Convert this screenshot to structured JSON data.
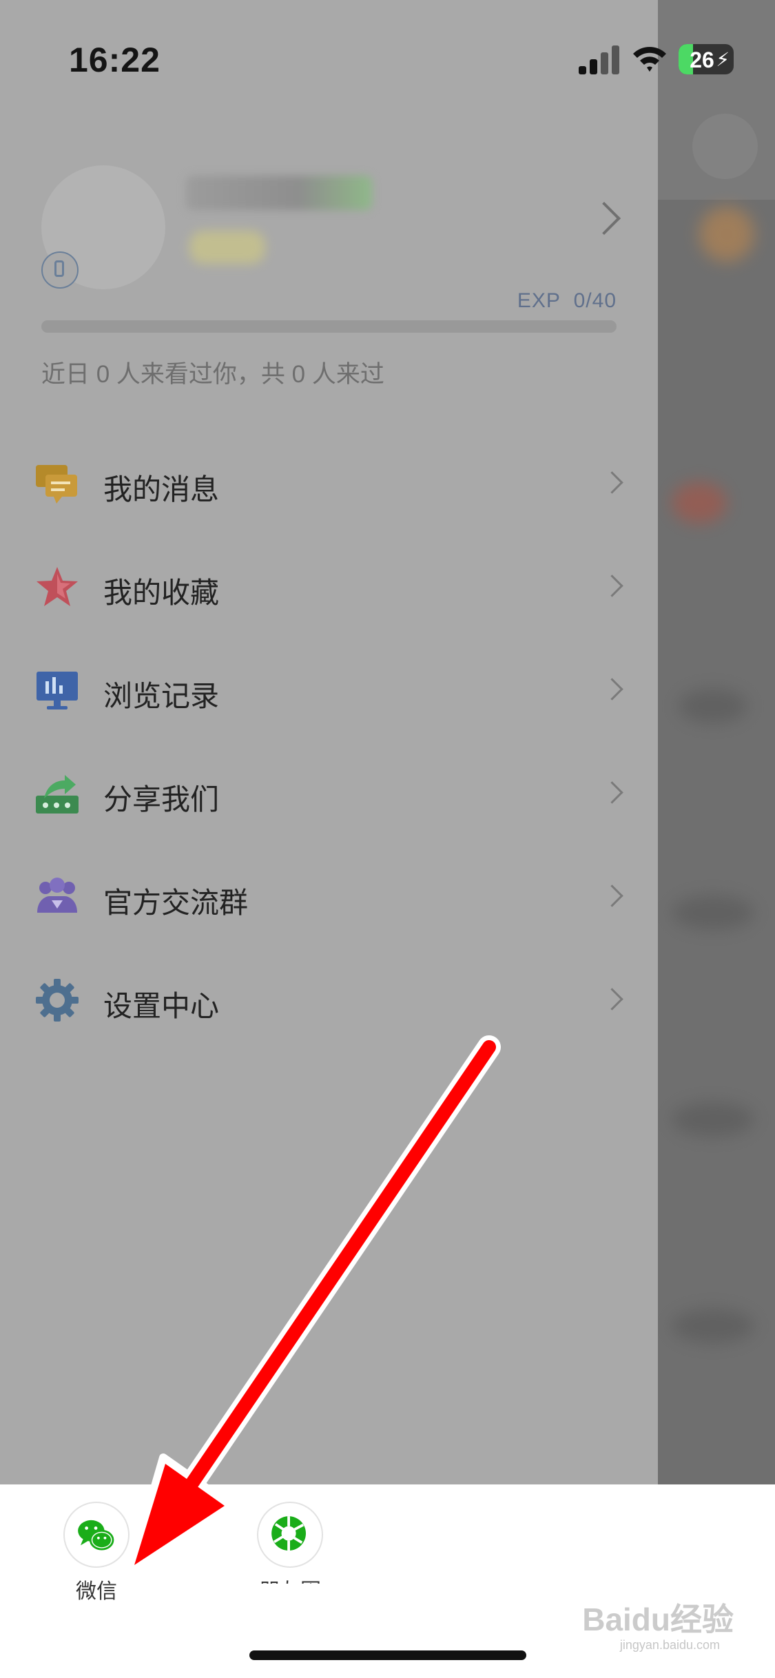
{
  "status_bar": {
    "time": "16:22",
    "battery": "26"
  },
  "profile": {
    "exp_label": "EXP",
    "exp_value": "0/40",
    "exp_progress": 0,
    "visits_text": "近日 0 人来看过你，共 0 人来过"
  },
  "menu": [
    {
      "label": "我的消息",
      "icon": "message-icon",
      "color": "#b58a2a"
    },
    {
      "label": "我的收藏",
      "icon": "star-icon",
      "color": "#c0505a"
    },
    {
      "label": "浏览记录",
      "icon": "history-icon",
      "color": "#3f64a8"
    },
    {
      "label": "分享我们",
      "icon": "share-icon",
      "color": "#3c8a50"
    },
    {
      "label": "官方交流群",
      "icon": "group-icon",
      "color": "#7060b0"
    },
    {
      "label": "设置中心",
      "icon": "gear-icon",
      "color": "#4e6f8f"
    }
  ],
  "share": {
    "options": [
      {
        "label": "微信",
        "icon": "wechat-icon",
        "color": "#1aad19"
      },
      {
        "label": "朋友圈",
        "icon": "moments-icon",
        "color": "#1aad19"
      }
    ]
  },
  "watermark": {
    "text": "Baidu经验",
    "sub": "jingyan.baidu.com"
  },
  "colors": {
    "annotation_arrow": "#ff0000"
  }
}
